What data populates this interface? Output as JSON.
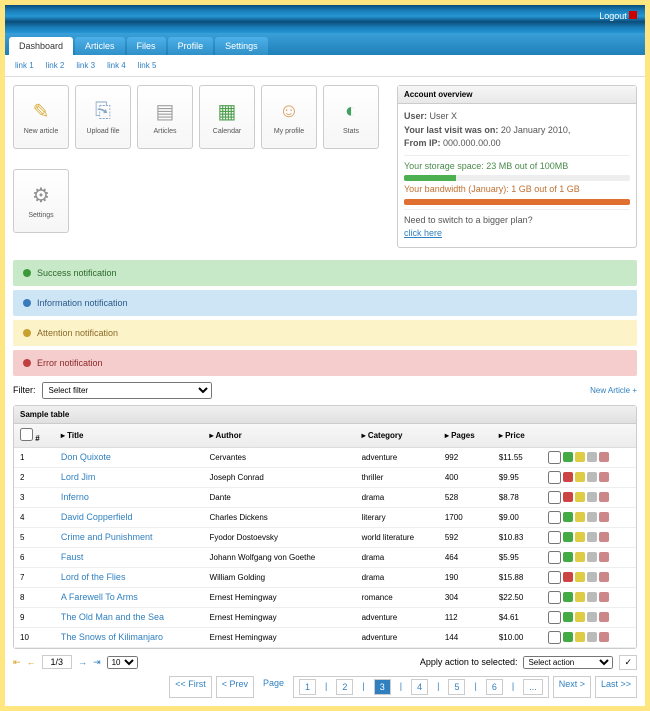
{
  "logout": "Logout",
  "tabs": [
    "Dashboard",
    "Articles",
    "Files",
    "Profile",
    "Settings"
  ],
  "sublinks": [
    "link 1",
    "link 2",
    "link 3",
    "link 4",
    "link 5"
  ],
  "tiles": [
    {
      "label": "New article",
      "icon": "pencil"
    },
    {
      "label": "Upload file",
      "icon": "file"
    },
    {
      "label": "Articles",
      "icon": "pages"
    },
    {
      "label": "Calendar",
      "icon": "calendar"
    },
    {
      "label": "My profile",
      "icon": "user"
    },
    {
      "label": "Stats",
      "icon": "chart"
    },
    {
      "label": "Settings",
      "icon": "gears"
    }
  ],
  "account": {
    "title": "Account overview",
    "user_label": "User:",
    "user": "User X",
    "visit_label": "Your last visit was on:",
    "visit": "20 January 2010,",
    "ip_label": "From IP:",
    "ip": "000.000.00.00",
    "storage": "Your storage space: 23 MB out of 100MB",
    "storage_pct": 23,
    "storage_color": "#4caf50",
    "bandwidth": "Your bandwidth (January): 1 GB out of 1 GB",
    "bandwidth_pct": 100,
    "bandwidth_color": "#e07030",
    "upgrade": "Need to switch to a bigger plan?",
    "upgrade_link": "click here"
  },
  "notifications": {
    "success": "Success notification",
    "info": "Information notification",
    "warn": "Attention notification",
    "error": "Error notification"
  },
  "filter": {
    "label": "Filter:",
    "placeholder": "Select filter",
    "new_article": "New Article +"
  },
  "table": {
    "title": "Sample table",
    "cols": [
      "#",
      "Title",
      "Author",
      "Category",
      "Pages",
      "Price",
      ""
    ],
    "rows": [
      {
        "n": 1,
        "title": "Don Quixote",
        "author": "Cervantes",
        "cat": "adventure",
        "pages": 992,
        "price": "$11.55",
        "ok": true
      },
      {
        "n": 2,
        "title": "Lord Jim",
        "author": "Joseph Conrad",
        "cat": "thriller",
        "pages": 400,
        "price": "$9.95",
        "ok": false
      },
      {
        "n": 3,
        "title": "Inferno",
        "author": "Dante",
        "cat": "drama",
        "pages": 528,
        "price": "$8.78",
        "ok": false
      },
      {
        "n": 4,
        "title": "David Copperfield",
        "author": "Charles Dickens",
        "cat": "literary",
        "pages": 1700,
        "price": "$9.00",
        "ok": true
      },
      {
        "n": 5,
        "title": "Crime and Punishment",
        "author": "Fyodor Dostoevsky",
        "cat": "world literature",
        "pages": 592,
        "price": "$10.83",
        "ok": true
      },
      {
        "n": 6,
        "title": "Faust",
        "author": "Johann Wolfgang von Goethe",
        "cat": "drama",
        "pages": 464,
        "price": "$5.95",
        "ok": true
      },
      {
        "n": 7,
        "title": "Lord of the Flies",
        "author": "William Golding",
        "cat": "drama",
        "pages": 190,
        "price": "$15.88",
        "ok": false
      },
      {
        "n": 8,
        "title": "A Farewell To Arms",
        "author": "Ernest Hemingway",
        "cat": "romance",
        "pages": 304,
        "price": "$22.50",
        "ok": true
      },
      {
        "n": 9,
        "title": "The Old Man and the Sea",
        "author": "Ernest Hemingway",
        "cat": "adventure",
        "pages": 112,
        "price": "$4.61",
        "ok": true
      },
      {
        "n": 10,
        "title": "The Snows of Kilimanjaro",
        "author": "Ernest Hemingway",
        "cat": "adventure",
        "pages": 144,
        "price": "$10.00",
        "ok": true
      }
    ]
  },
  "footer": {
    "page_of": "1/3",
    "per_page": "10",
    "apply_label": "Apply action to selected:",
    "apply_placeholder": "Select action"
  },
  "pager": {
    "first": "<< First",
    "prev": "< Prev",
    "label": "Page",
    "pages": [
      "1",
      "2",
      "3",
      "4",
      "5",
      "6",
      "..."
    ],
    "next": "Next >",
    "last": "Last >>"
  }
}
